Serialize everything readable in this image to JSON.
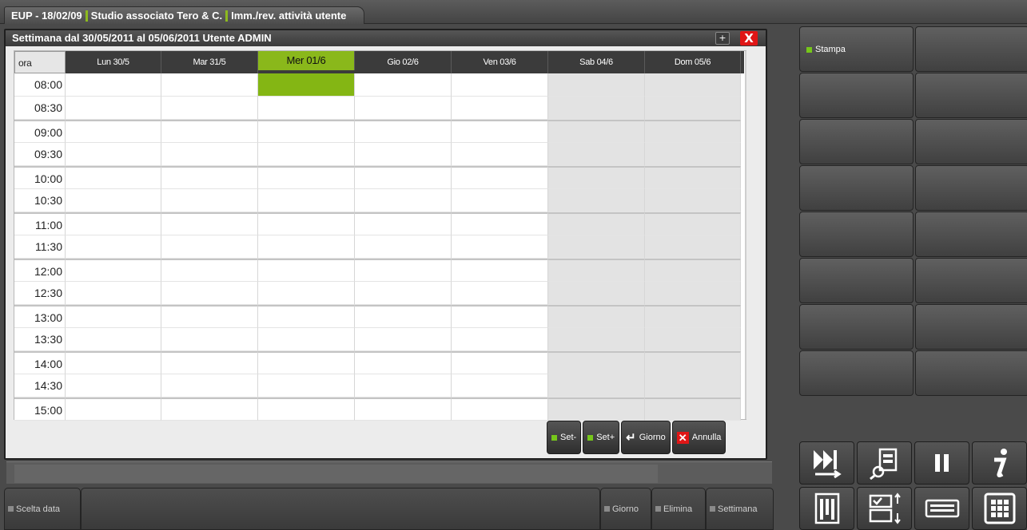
{
  "tabbar": {
    "tab1": "EUP - 18/02/09",
    "tab2": "Studio associato Tero & C.",
    "tab3": "Imm./rev. attività utente"
  },
  "window": {
    "title": "Settimana dal 30/05/2011 al 05/06/2011 Utente ADMIN",
    "maximize_label": "+",
    "close_label": "X"
  },
  "calendar": {
    "header_ora": "ora",
    "days": [
      "Lun 30/5",
      "Mar 31/5",
      "Mer 01/6",
      "Gio 02/6",
      "Ven 03/6",
      "Sab 04/6",
      "Dom 05/6"
    ],
    "active_day_index": 2,
    "weekend_indices": [
      5,
      6
    ],
    "selected_slot": {
      "day_index": 2,
      "time": "08:00"
    },
    "times": [
      "08:00",
      "08:30",
      "09:00",
      "09:30",
      "10:00",
      "10:30",
      "11:00",
      "11:30",
      "12:00",
      "12:30",
      "13:00",
      "13:30",
      "14:00",
      "14:30",
      "15:00"
    ]
  },
  "actions": {
    "set_minus": "Set-",
    "set_plus": "Set+",
    "giorno": "Giorno",
    "annulla": "Annulla"
  },
  "fbar": {
    "scelta_data": "Scelta data",
    "giorno": "Giorno",
    "elimina": "Elimina",
    "settimana": "Settimana"
  },
  "rpanel": {
    "stampa": "Stampa"
  },
  "colors": {
    "accent_green": "#84b614",
    "close_red": "#e01616"
  }
}
